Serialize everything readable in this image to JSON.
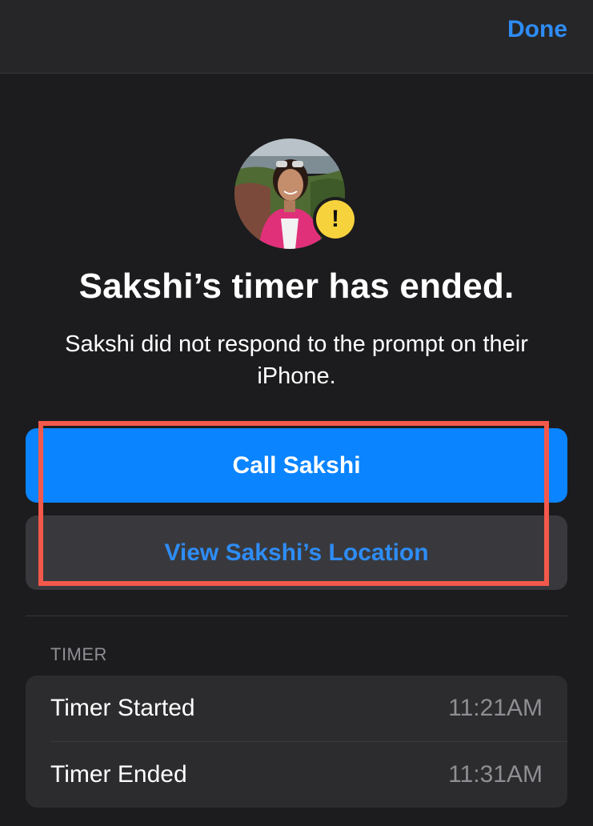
{
  "nav": {
    "done_label": "Done"
  },
  "alert": {
    "avatar_icon": "person-photo-avatar",
    "badge_icon": "exclamation-icon",
    "badge_symbol": "!",
    "title": "Sakshi’s timer has ended.",
    "message": "Sakshi did not respond to the prompt on their iPhone."
  },
  "actions": {
    "call_label": "Call Sakshi",
    "location_label": "View Sakshi’s Location"
  },
  "timer_section": {
    "header": "TIMER",
    "rows": [
      {
        "label": "Timer Started",
        "value": "11:21AM"
      },
      {
        "label": "Timer Ended",
        "value": "11:31AM"
      }
    ]
  },
  "colors": {
    "background": "#1c1c1e",
    "accent_blue": "#0a84ff",
    "link_blue": "#2e8cf5",
    "badge_yellow": "#f6d33c",
    "highlight_red": "#f2594b",
    "secondary_text": "#8e8e93"
  }
}
